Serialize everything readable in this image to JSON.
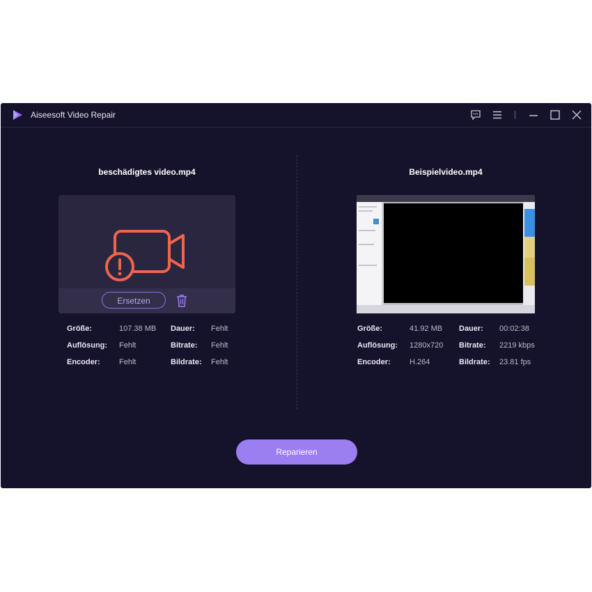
{
  "app": {
    "title": "Aiseesoft Video Repair"
  },
  "titlebar": {
    "icons": [
      "feedback-icon",
      "menu-icon",
      "minimize-icon",
      "maximize-icon",
      "close-icon"
    ]
  },
  "left": {
    "file_name": "beschädigtes video.mp4",
    "replace_label": "Ersetzen",
    "info": {
      "size_label": "Größe:",
      "size_value": "107.38 MB",
      "duration_label": "Dauer:",
      "duration_value": "Fehlt",
      "resolution_label": "Auflösung:",
      "resolution_value": "Fehlt",
      "bitrate_label": "Bitrate:",
      "bitrate_value": "Fehlt",
      "encoder_label": "Encoder:",
      "encoder_value": "Fehlt",
      "framerate_label": "Bildrate:",
      "framerate_value": "Fehlt"
    }
  },
  "right": {
    "file_name": "Beispielvideo.mp4",
    "info": {
      "size_label": "Größe:",
      "size_value": "41.92 MB",
      "duration_label": "Dauer:",
      "duration_value": "00:02:38",
      "resolution_label": "Auflösung:",
      "resolution_value": "1280x720",
      "bitrate_label": "Bitrate:",
      "bitrate_value": "2219 kbps",
      "encoder_label": "Encoder:",
      "encoder_value": "H.264",
      "framerate_label": "Bildrate:",
      "framerate_value": "23.81 fps"
    }
  },
  "repair_label": "Reparieren",
  "colors": {
    "background": "#15122b",
    "accent": "#9b7ef0",
    "warning": "#f0644c"
  }
}
